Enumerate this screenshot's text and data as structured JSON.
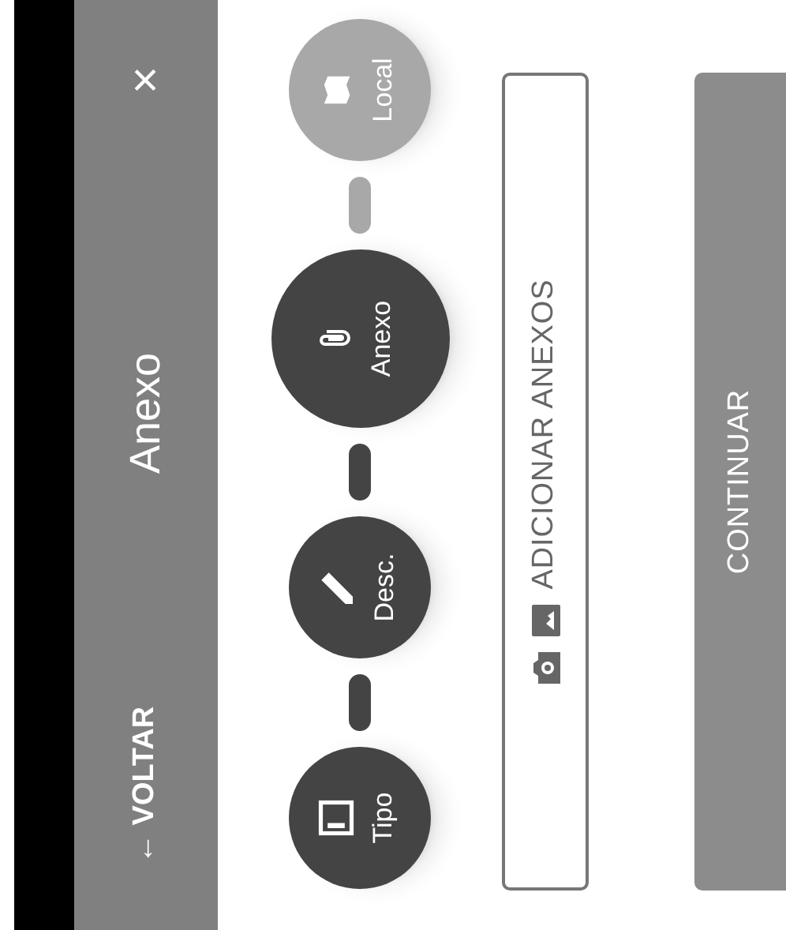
{
  "header": {
    "back": "← VOLTAR",
    "title": "Anexo",
    "close": "×"
  },
  "steps": [
    {
      "label": "Tipo",
      "done": true,
      "selected": false
    },
    {
      "label": "Desc.",
      "done": true,
      "selected": false
    },
    {
      "label": "Anexo",
      "done": false,
      "selected": true
    },
    {
      "label": "Local",
      "done": false,
      "selected": false
    }
  ],
  "buttons": [
    {
      "label": "ADICIONAR ANEXOS",
      "kind": "outline"
    },
    {
      "label": "CONTINUAR",
      "kind": "filled"
    }
  ]
}
